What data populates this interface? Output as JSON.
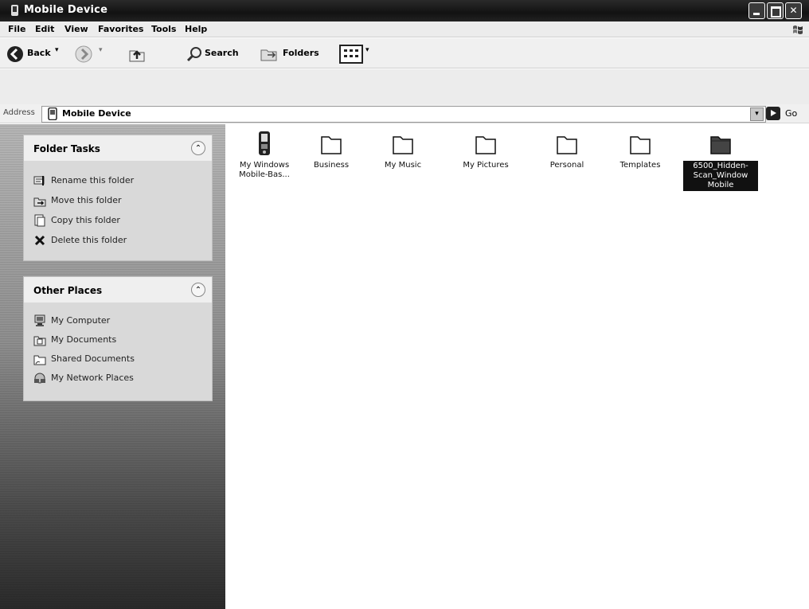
{
  "window": {
    "title": "Mobile Device",
    "controls": {
      "minimize": "",
      "maximize": "",
      "close": "✕"
    }
  },
  "menu": [
    "File",
    "Edit",
    "View",
    "Favorites",
    "Tools",
    "Help"
  ],
  "toolbar": {
    "back": "Back",
    "search": "Search",
    "folders": "Folders"
  },
  "address": {
    "label": "Address",
    "value": "Mobile Device",
    "go": "Go"
  },
  "folder_tasks": {
    "title": "Folder Tasks",
    "collapse": "⌃",
    "items": [
      {
        "label": "Rename this folder",
        "icon": "rename-icon"
      },
      {
        "label": "Move this folder",
        "icon": "move-icon"
      },
      {
        "label": "Copy this folder",
        "icon": "copy-icon"
      },
      {
        "label": "Delete this folder",
        "icon": "delete-icon"
      }
    ]
  },
  "other_places": {
    "title": "Other Places",
    "collapse": "⌃",
    "items": [
      {
        "label": "My Computer",
        "icon": "computer-icon"
      },
      {
        "label": "My Documents",
        "icon": "documents-icon"
      },
      {
        "label": "Shared Documents",
        "icon": "shared-folder-icon"
      },
      {
        "label": "My Network Places",
        "icon": "network-icon"
      }
    ]
  },
  "files": [
    {
      "name": "My Windows Mobile-Bas...",
      "icon": "mobile-device-icon"
    },
    {
      "name": "Business",
      "icon": "folder-icon"
    },
    {
      "name": "My Music",
      "icon": "folder-icon"
    },
    {
      "name": "My Pictures",
      "icon": "folder-icon"
    },
    {
      "name": "Personal",
      "icon": "folder-icon"
    },
    {
      "name": "Templates",
      "icon": "folder-icon"
    },
    {
      "name": "6500_Hidden-Scan_Window Mobile",
      "icon": "folder-icon",
      "selected": true
    }
  ]
}
